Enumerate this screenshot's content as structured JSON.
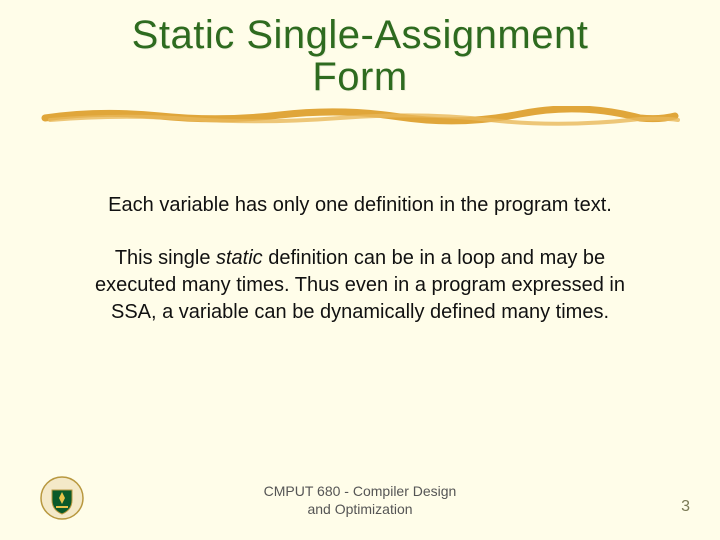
{
  "title_line1": "Static Single-Assignment",
  "title_line2": "Form",
  "line1": "Each variable has only one definition in the program text.",
  "para_part1": "This single ",
  "para_static": "static",
  "para_part2": " definition can be in a loop and may be executed many times. Thus even in a program expressed in SSA, a variable can be dynamically defined many times.",
  "footer_line1": "CMPUT 680 - Compiler Design",
  "footer_line2": "and Optimization",
  "page_number": "3",
  "logo_alt": "University of Alberta crest"
}
